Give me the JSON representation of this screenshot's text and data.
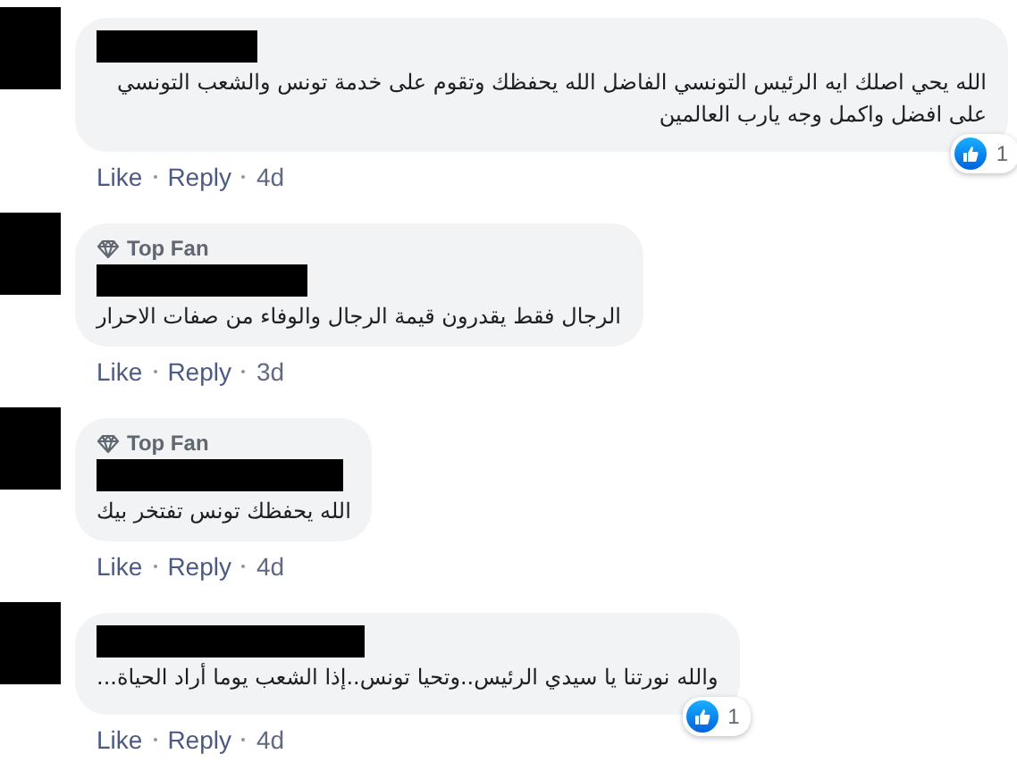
{
  "comments": [
    {
      "text": "الله يحي اصلك ايه الرئيس التونسي الفاضل الله يحفظك وتقوم على خدمة تونس والشعب التونسي على افضل واكمل وجه يارب العالمين",
      "reactions": "1",
      "like": "Like",
      "reply": "Reply",
      "time": "4d"
    },
    {
      "badge": "Top Fan",
      "text": "الرجال فقط يقدرون قيمة الرجال والوفاء من صفات الاحرار",
      "like": "Like",
      "reply": "Reply",
      "time": "3d"
    },
    {
      "badge": "Top Fan",
      "text": "الله يحفظك تونس تفتخر بيك",
      "like": "Like",
      "reply": "Reply",
      "time": "4d"
    },
    {
      "text": "والله نورتنا يا سيدي الرئيس..وتحيا تونس..إذا الشعب يوما أراد الحياة...",
      "reactions": "1",
      "like": "Like",
      "reply": "Reply",
      "time": "4d"
    }
  ]
}
